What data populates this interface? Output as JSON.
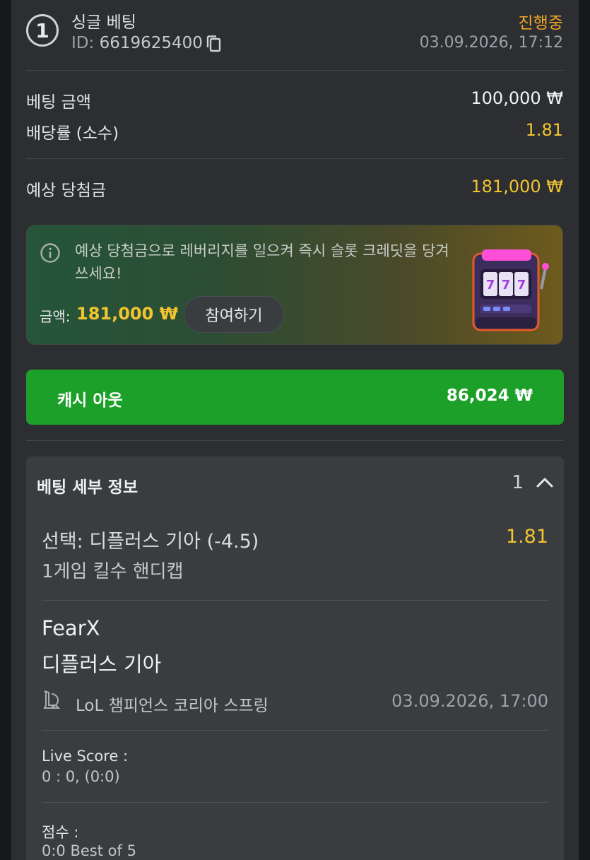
{
  "bet": {
    "number": "1",
    "type": "싱글 베팅",
    "id_label": "ID:",
    "id_value": "6619625400",
    "status": "진행중",
    "datetime": "03.09.2026, 17:12"
  },
  "summary": {
    "stake_label": "베팅 금액",
    "stake_value": "100,000 ₩",
    "odds_label": "배당률 (소수)",
    "odds_value": "1.81",
    "potential_label": "예상 당첨금",
    "potential_value": "181,000 ₩"
  },
  "promo": {
    "text": "예상 당첨금으로 레버리지를 일으켜 즉시 슬롯 크레딧을 당겨 쓰세요!",
    "amount_label": "금액:",
    "amount_value": "181,000 ₩",
    "join_label": "참여하기"
  },
  "cashout": {
    "label": "캐시 아웃",
    "value": "86,024 ₩"
  },
  "details": {
    "title": "베팅 세부 정보",
    "count": "1",
    "selection": "선택: 디플러스 기아 (-4.5)",
    "selection_odds": "1.81",
    "market": "1게임 킬수 핸디캡",
    "team1": "FearX",
    "team2": "디플러스 기아",
    "league": "LoL 챔피언스 코리아 스프링",
    "match_datetime": "03.09.2026, 17:00",
    "live_score_label": "Live Score :",
    "live_score_value": "0 : 0, (0:0)",
    "score_label": "점수 :",
    "score_value": "0:0 Best of 5"
  },
  "colors": {
    "accent_yellow": "#f2c431",
    "status_orange": "#f0a526",
    "cashout_green": "#1da02a"
  }
}
